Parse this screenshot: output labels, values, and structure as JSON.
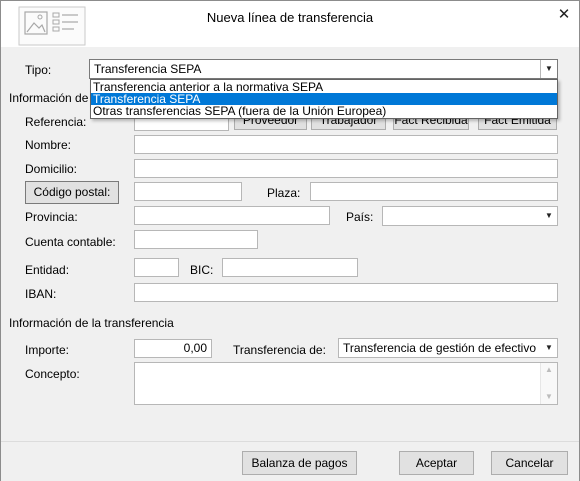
{
  "window": {
    "title": "Nueva línea de transferencia",
    "close_glyph": "✕"
  },
  "form": {
    "tipo_label": "Tipo:",
    "tipo_value": "Transferencia SEPA",
    "tipo_options": [
      "Transferencia anterior a la normativa SEPA",
      "Transferencia SEPA",
      "Otras transferencias SEPA (fuera de la Unión Europea)"
    ],
    "info_section_partial": "Información de",
    "referencia_label": "Referencia:",
    "ref_buttons": [
      "Proveedor",
      "Trabajador",
      "Fact Recibida",
      "Fact Emitida"
    ],
    "nombre_label": "Nombre:",
    "domicilio_label": "Domicilio:",
    "codigo_postal_button": "Código postal:",
    "plaza_label": "Plaza:",
    "provincia_label": "Provincia:",
    "pais_label": "País:",
    "cuenta_label": "Cuenta contable:",
    "entidad_label": "Entidad:",
    "bic_label": "BIC:",
    "iban_label": "IBAN:",
    "transfer_section": "Información de la transferencia",
    "importe_label": "Importe:",
    "importe_value": "0,00",
    "transferencia_de_label": "Transferencia de:",
    "transferencia_de_value": "Transferencia de gestión de efectivo",
    "concepto_label": "Concepto:"
  },
  "footer": {
    "balanza": "Balanza de pagos",
    "aceptar": "Aceptar",
    "cancelar": "Cancelar"
  }
}
